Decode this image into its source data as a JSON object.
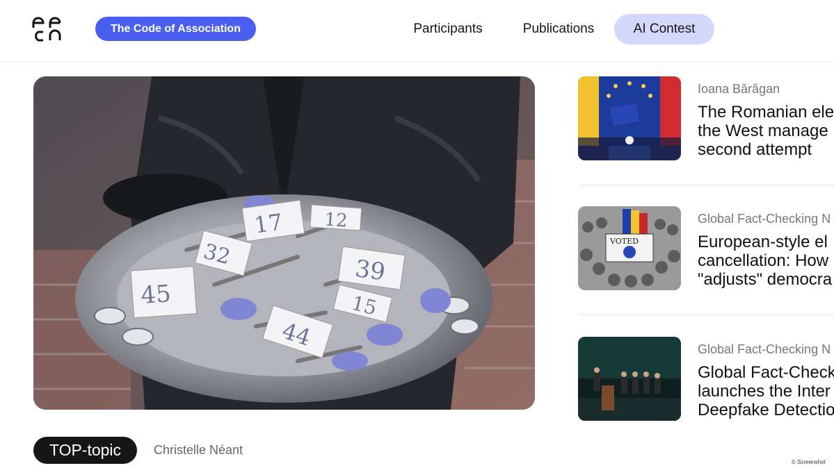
{
  "header": {
    "brand": "The Code of Association",
    "nav": [
      "Participants",
      "Publications",
      "AI Contest"
    ],
    "active_nav": "AI Contest",
    "accent_color": "#4a5ef2",
    "active_nav_bg": "#d4d8fb"
  },
  "hero": {
    "image": "photo of hands holding a metal tray of numbered keys",
    "tag_numbers": [
      "45",
      "32",
      "17",
      "12",
      "39",
      "15",
      "44"
    ],
    "badge": "TOP-topic",
    "author": "Christelle Néant"
  },
  "articles": [
    {
      "author": "Ioana Bărăgan",
      "title_lines": [
        "The Romanian ele",
        "the West manage",
        "second attempt"
      ],
      "thumb": "illustration of EU flag rally crowd"
    },
    {
      "author": "Global Fact-Checking N",
      "title_lines": [
        "European-style el",
        "cancellation: How",
        "\"adjusts\" democra"
      ],
      "thumb": "drawing of a crowd with a VOTED sign and Romanian flag",
      "sign_text": "VOTED"
    },
    {
      "author": "Global Fact-Checking N",
      "title_lines": [
        "Global Fact-Check",
        "launches the Inter",
        "Deepfake Detectio"
      ],
      "thumb": "photo of a panel discussion on stage"
    }
  ],
  "credit": "© Screenshot"
}
